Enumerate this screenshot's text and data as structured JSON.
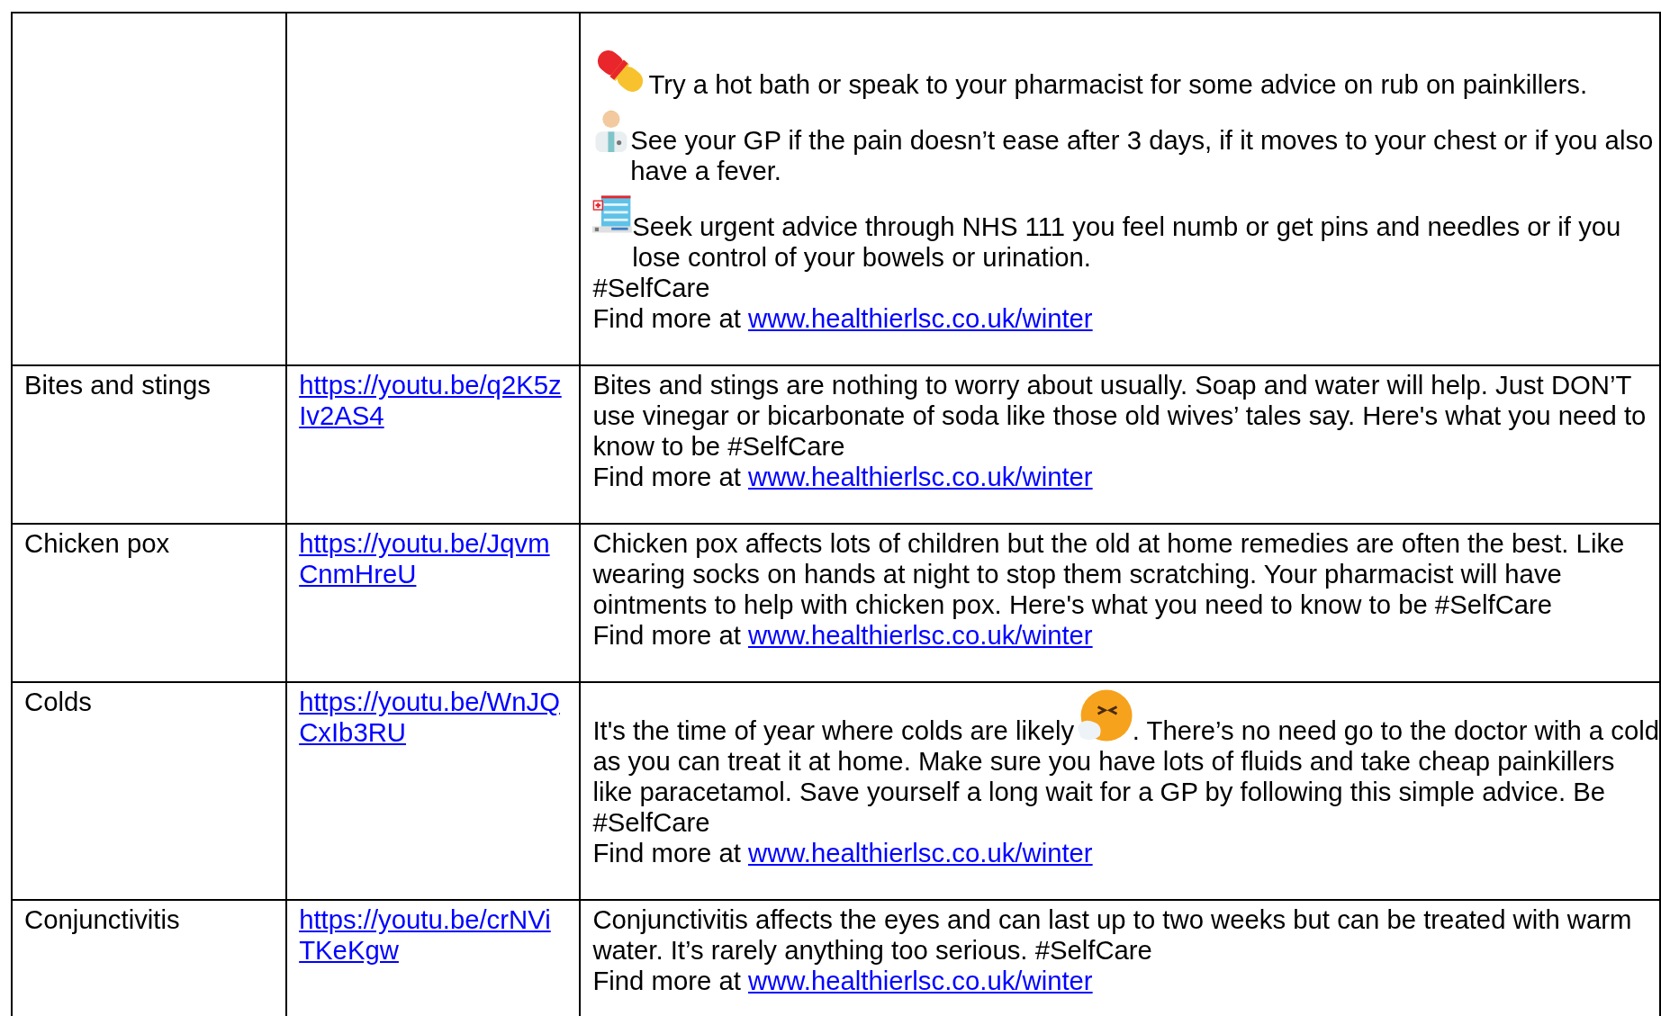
{
  "rows": [
    {
      "condition": "",
      "video_link": "",
      "paragraphs": [
        {
          "kind": "pharmacy",
          "text": "Try a hot bath or speak to your pharmacist for some advice on rub on painkillers."
        },
        {
          "kind": "gp",
          "text": "See your GP if the pain doesn’t ease after 3 days, if it moves to your chest or if you also have a fever."
        },
        {
          "kind": "urgent",
          "text": "Seek urgent advice through NHS 111 you feel numb or get pins and needles or if you lose control of your bowels or urination."
        },
        {
          "kind": "plain",
          "text": "#SelfCare"
        }
      ],
      "find_more": {
        "prefix": "Find more at",
        "link": "www.healthierlsc.co.uk/winter"
      }
    },
    {
      "condition": "Bites and stings",
      "video_link": "https://youtu.be/q2K5zIv2AS4",
      "paragraphs": [
        {
          "kind": "plain",
          "text": "Bites and stings are nothing to worry about usually. Soap and water will help. Just DON’T use vinegar or bicarbonate of soda like those old wives’ tales say. Here's what you need to know to be #SelfCare"
        }
      ],
      "find_more": {
        "prefix": "Find more at",
        "link": "www.healthierlsc.co.uk/winter"
      }
    },
    {
      "condition": "Chicken pox",
      "video_link": "https://youtu.be/JqvmCnmHreU",
      "paragraphs": [
        {
          "kind": "plain",
          "text": "Chicken pox affects lots of children but the old at home remedies are often the best. Like wearing socks on hands at night to stop them scratching. Your pharmacist will have ointments to help with chicken pox.  Here's what you need to know to be #SelfCare"
        }
      ],
      "find_more": {
        "prefix": "Find more at",
        "link": "www.healthierlsc.co.uk/winter"
      }
    },
    {
      "condition": "Colds",
      "video_link": "https://youtu.be/WnJQCxIb3RU",
      "paragraphs": [
        {
          "kind": "sneeze",
          "before": "It's the time of year where colds are likely",
          "after": ". There’s no need go to the doctor with a cold",
          "text": "as you can treat it at home. Make sure you have lots of fluids and take cheap painkillers like paracetamol.  Save yourself a long wait for a GP by following this simple advice. Be #SelfCare"
        }
      ],
      "find_more": {
        "prefix": "Find more at",
        "link": "www.healthierlsc.co.uk/winter"
      }
    },
    {
      "condition": "Conjunctivitis",
      "video_link": "https://youtu.be/crNViTKeKgw",
      "paragraphs": [
        {
          "kind": "plain",
          "text": "Conjunctivitis affects the eyes and can last up to two weeks but can be treated with warm water. It’s rarely anything too serious. #SelfCare"
        }
      ],
      "find_more": {
        "prefix": "Find more at",
        "link": "www.healthierlsc.co.uk/winter"
      }
    }
  ]
}
